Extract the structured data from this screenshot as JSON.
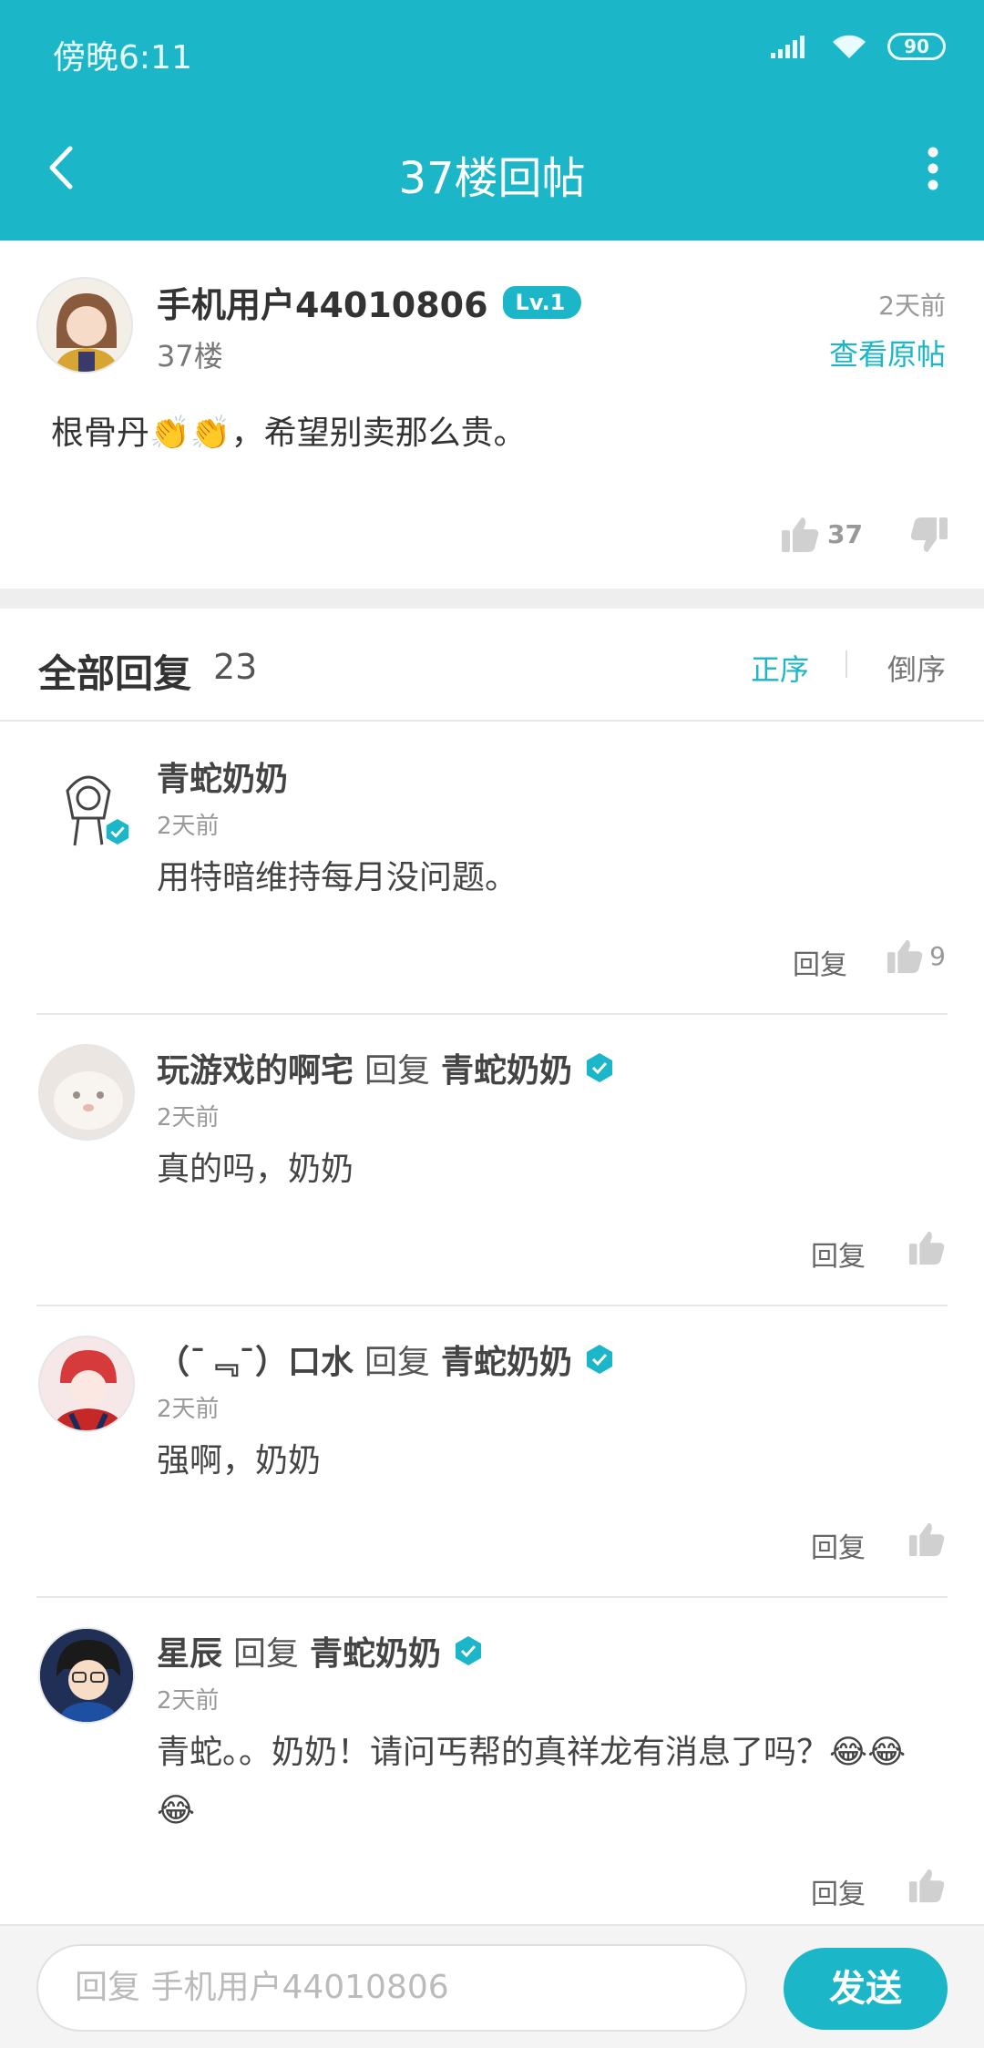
{
  "status_bar": {
    "time": "傍晚6:11",
    "battery": "90"
  },
  "nav": {
    "title": "37楼回帖"
  },
  "post": {
    "username": "手机用户44010806",
    "level": "Lv.1",
    "floor": "37楼",
    "time": "2天前",
    "view_original": "查看原帖",
    "content": "根骨丹👏👏，希望别卖那么贵。",
    "likes": "37"
  },
  "replies_header": {
    "title": "全部回复",
    "count": "23",
    "sort_asc": "正序",
    "sort_desc": "倒序"
  },
  "replies": [
    {
      "name": "青蛇奶奶",
      "reply_word": "",
      "reply_to": "",
      "time": "2天前",
      "text": "用特暗维持每月没问题。",
      "action": "回复",
      "likes": "9"
    },
    {
      "name": "玩游戏的啊宅",
      "reply_word": "回复",
      "reply_to": "青蛇奶奶",
      "time": "2天前",
      "text": "真的吗，奶奶",
      "action": "回复",
      "likes": ""
    },
    {
      "name": "（¯﹃¯）口水",
      "reply_word": "回复",
      "reply_to": "青蛇奶奶",
      "time": "2天前",
      "text": "强啊，奶奶",
      "action": "回复",
      "likes": ""
    },
    {
      "name": "星辰",
      "reply_word": "回复",
      "reply_to": "青蛇奶奶",
      "time": "2天前",
      "text": "青蛇。。奶奶！请问丐帮的真祥龙有消息了吗？😂😂😂",
      "action": "回复",
      "likes": ""
    }
  ],
  "bottom_bar": {
    "placeholder": "回复 手机用户44010806",
    "send": "发送"
  },
  "colors": {
    "accent": "#1bb7c9",
    "divider": "#eeeeee"
  }
}
